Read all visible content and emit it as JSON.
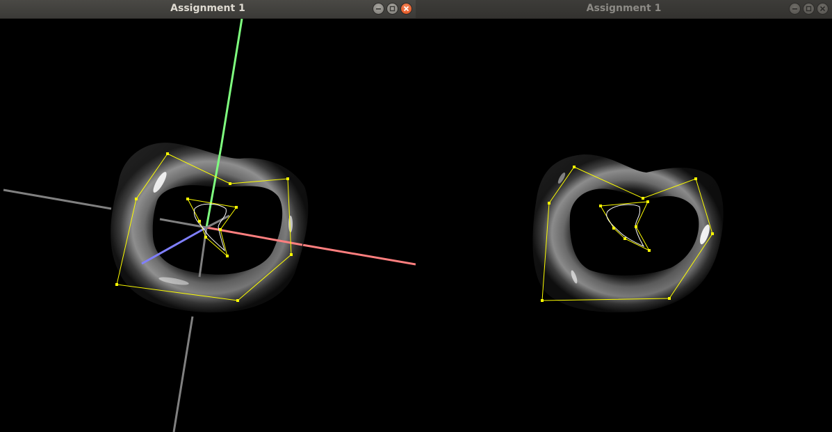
{
  "windows": [
    {
      "title": "Assignment 1",
      "focused": true
    },
    {
      "title": "Assignment 1",
      "focused": false
    }
  ],
  "controls": {
    "minimize": "minimize-icon",
    "maximize": "maximize-icon",
    "close": "close-icon"
  },
  "colors": {
    "titlebar_active": "#3f3e3b",
    "title_active": "#dfdbd2",
    "title_inactive": "#8c8a85",
    "close_button": "#e95420",
    "background": "#000000",
    "axis_x": "#ff7f7f",
    "axis_y": "#7fff7f",
    "axis_z": "#7f7fff",
    "axis_negative": "#808080",
    "control_polygon": "#ffff00",
    "curve": "#ffffff"
  }
}
